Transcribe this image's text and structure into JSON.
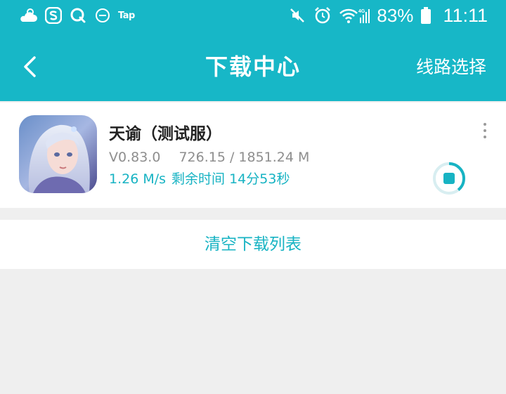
{
  "status_bar": {
    "app_label": "Tap",
    "battery_percent": "83%",
    "time": "11:11",
    "signal_label": "4G",
    "icons": [
      "weather-icon",
      "sogou-icon",
      "search-q-icon",
      "do-not-disturb-icon",
      "mute-icon",
      "alarm-icon",
      "wifi-icon",
      "signal-icon",
      "battery-icon"
    ]
  },
  "header": {
    "title": "下载中心",
    "route_select_label": "线路选择",
    "back_icon": "chevron-left-icon"
  },
  "download_item": {
    "name": "天谕（测试服）",
    "version": "V0.83.0",
    "size": "726.15 / 1851.24 M",
    "speed": "1.26 M/s",
    "remaining": "剩余时间 14分53秒",
    "progress_fraction": 0.392
  },
  "clear_label": "清空下载列表",
  "colors": {
    "accent": "#17b7c7",
    "text_primary": "#222222",
    "text_secondary": "#8e8e8e",
    "background": "#efefef"
  }
}
